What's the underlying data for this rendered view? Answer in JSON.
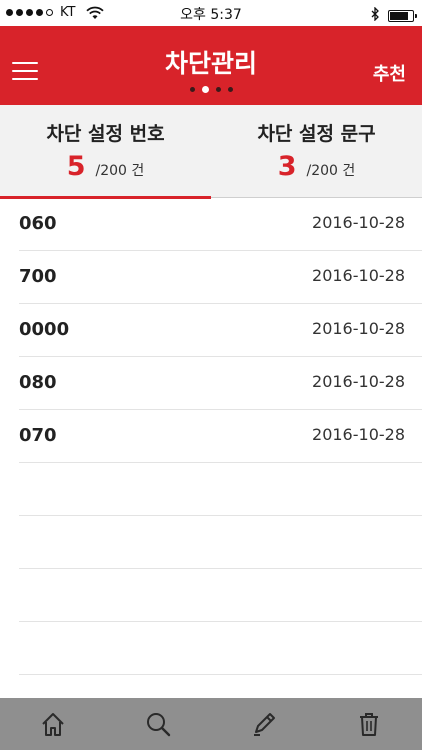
{
  "status_bar": {
    "carrier": "KT",
    "time": "오후 5:37",
    "signal_bars_filled": 4,
    "signal_bars_total": 5,
    "battery_level": 0.9
  },
  "header": {
    "title": "차단관리",
    "action_label": "추천",
    "menu_icon": "hamburger-menu-icon",
    "page_count": 4,
    "active_page": 2,
    "color": "#d8232a"
  },
  "tabs": [
    {
      "label": "차단 설정 번호",
      "count": "5",
      "total": "/200 건",
      "active": true
    },
    {
      "label": "차단 설정 문구",
      "count": "3",
      "total": "/200 건",
      "active": false
    }
  ],
  "list": {
    "rows": [
      {
        "number": "060",
        "date": "2016-10-28"
      },
      {
        "number": "700",
        "date": "2016-10-28"
      },
      {
        "number": "0000",
        "date": "2016-10-28"
      },
      {
        "number": "080",
        "date": "2016-10-28"
      },
      {
        "number": "070",
        "date": "2016-10-28"
      }
    ],
    "empty_rows": 4
  },
  "toolbar": {
    "icons": [
      "home-icon",
      "search-icon",
      "edit-icon",
      "trash-icon"
    ]
  }
}
